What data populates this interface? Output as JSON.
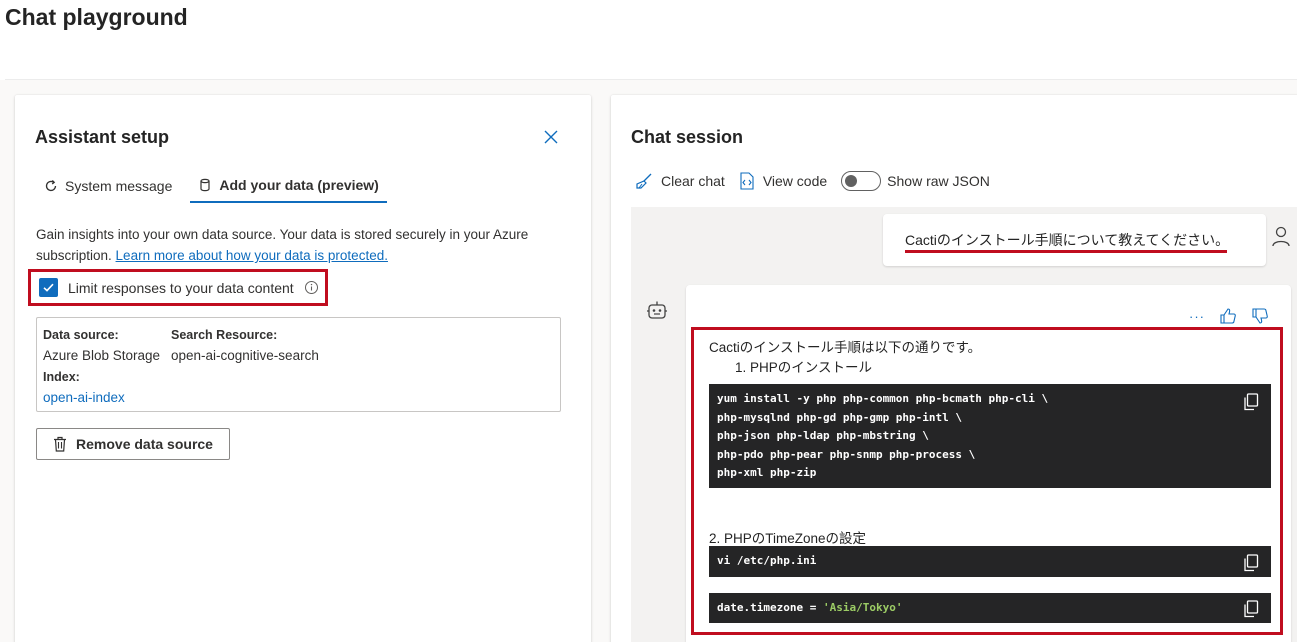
{
  "page": {
    "title": "Chat playground"
  },
  "assistant_setup": {
    "title": "Assistant setup",
    "tabs": [
      {
        "label": "System message",
        "icon": "refresh-icon"
      },
      {
        "label": "Add your data (preview)",
        "icon": "database-icon"
      }
    ],
    "description": "Gain insights into your own data source. Your data is stored securely in your Azure subscription. ",
    "learn_more_link": "Learn more about how your data is protected.",
    "limit_checkbox_label": "Limit responses to your data content",
    "data_source": {
      "data_source_label": "Data source:",
      "data_source_value": "Azure Blob Storage",
      "search_resource_label": "Search Resource:",
      "search_resource_value": "open-ai-cognitive-search",
      "index_label": "Index:",
      "index_value": "open-ai-index"
    },
    "remove_button": "Remove data source"
  },
  "chat_session": {
    "title": "Chat session",
    "toolbar": {
      "clear_chat": "Clear chat",
      "view_code": "View code",
      "show_raw_json": "Show raw JSON"
    },
    "user_message": "Cactiのインストール手順について教えてください。",
    "assistant": {
      "more_actions": "···",
      "intro": "Cactiのインストール手順は以下の通りです。",
      "step1": "1. PHPのインストール",
      "code1": [
        "yum install -y php php-common php-bcmath php-cli \\",
        "php-mysqlnd php-gd php-gmp php-intl \\",
        "php-json php-ldap php-mbstring \\",
        "php-pdo php-pear php-snmp php-process \\",
        "php-xml php-zip"
      ],
      "step2": "2. PHPのTimeZoneの設定",
      "code2": "vi /etc/php.ini",
      "code3_prefix": "date.timezone = ",
      "code3_value": "'Asia/Tokyo'"
    }
  },
  "colors": {
    "accent": "#0f6cbd",
    "highlight_red": "#c00d1f",
    "code_bg": "#252526",
    "string_green": "#9ccc65"
  }
}
